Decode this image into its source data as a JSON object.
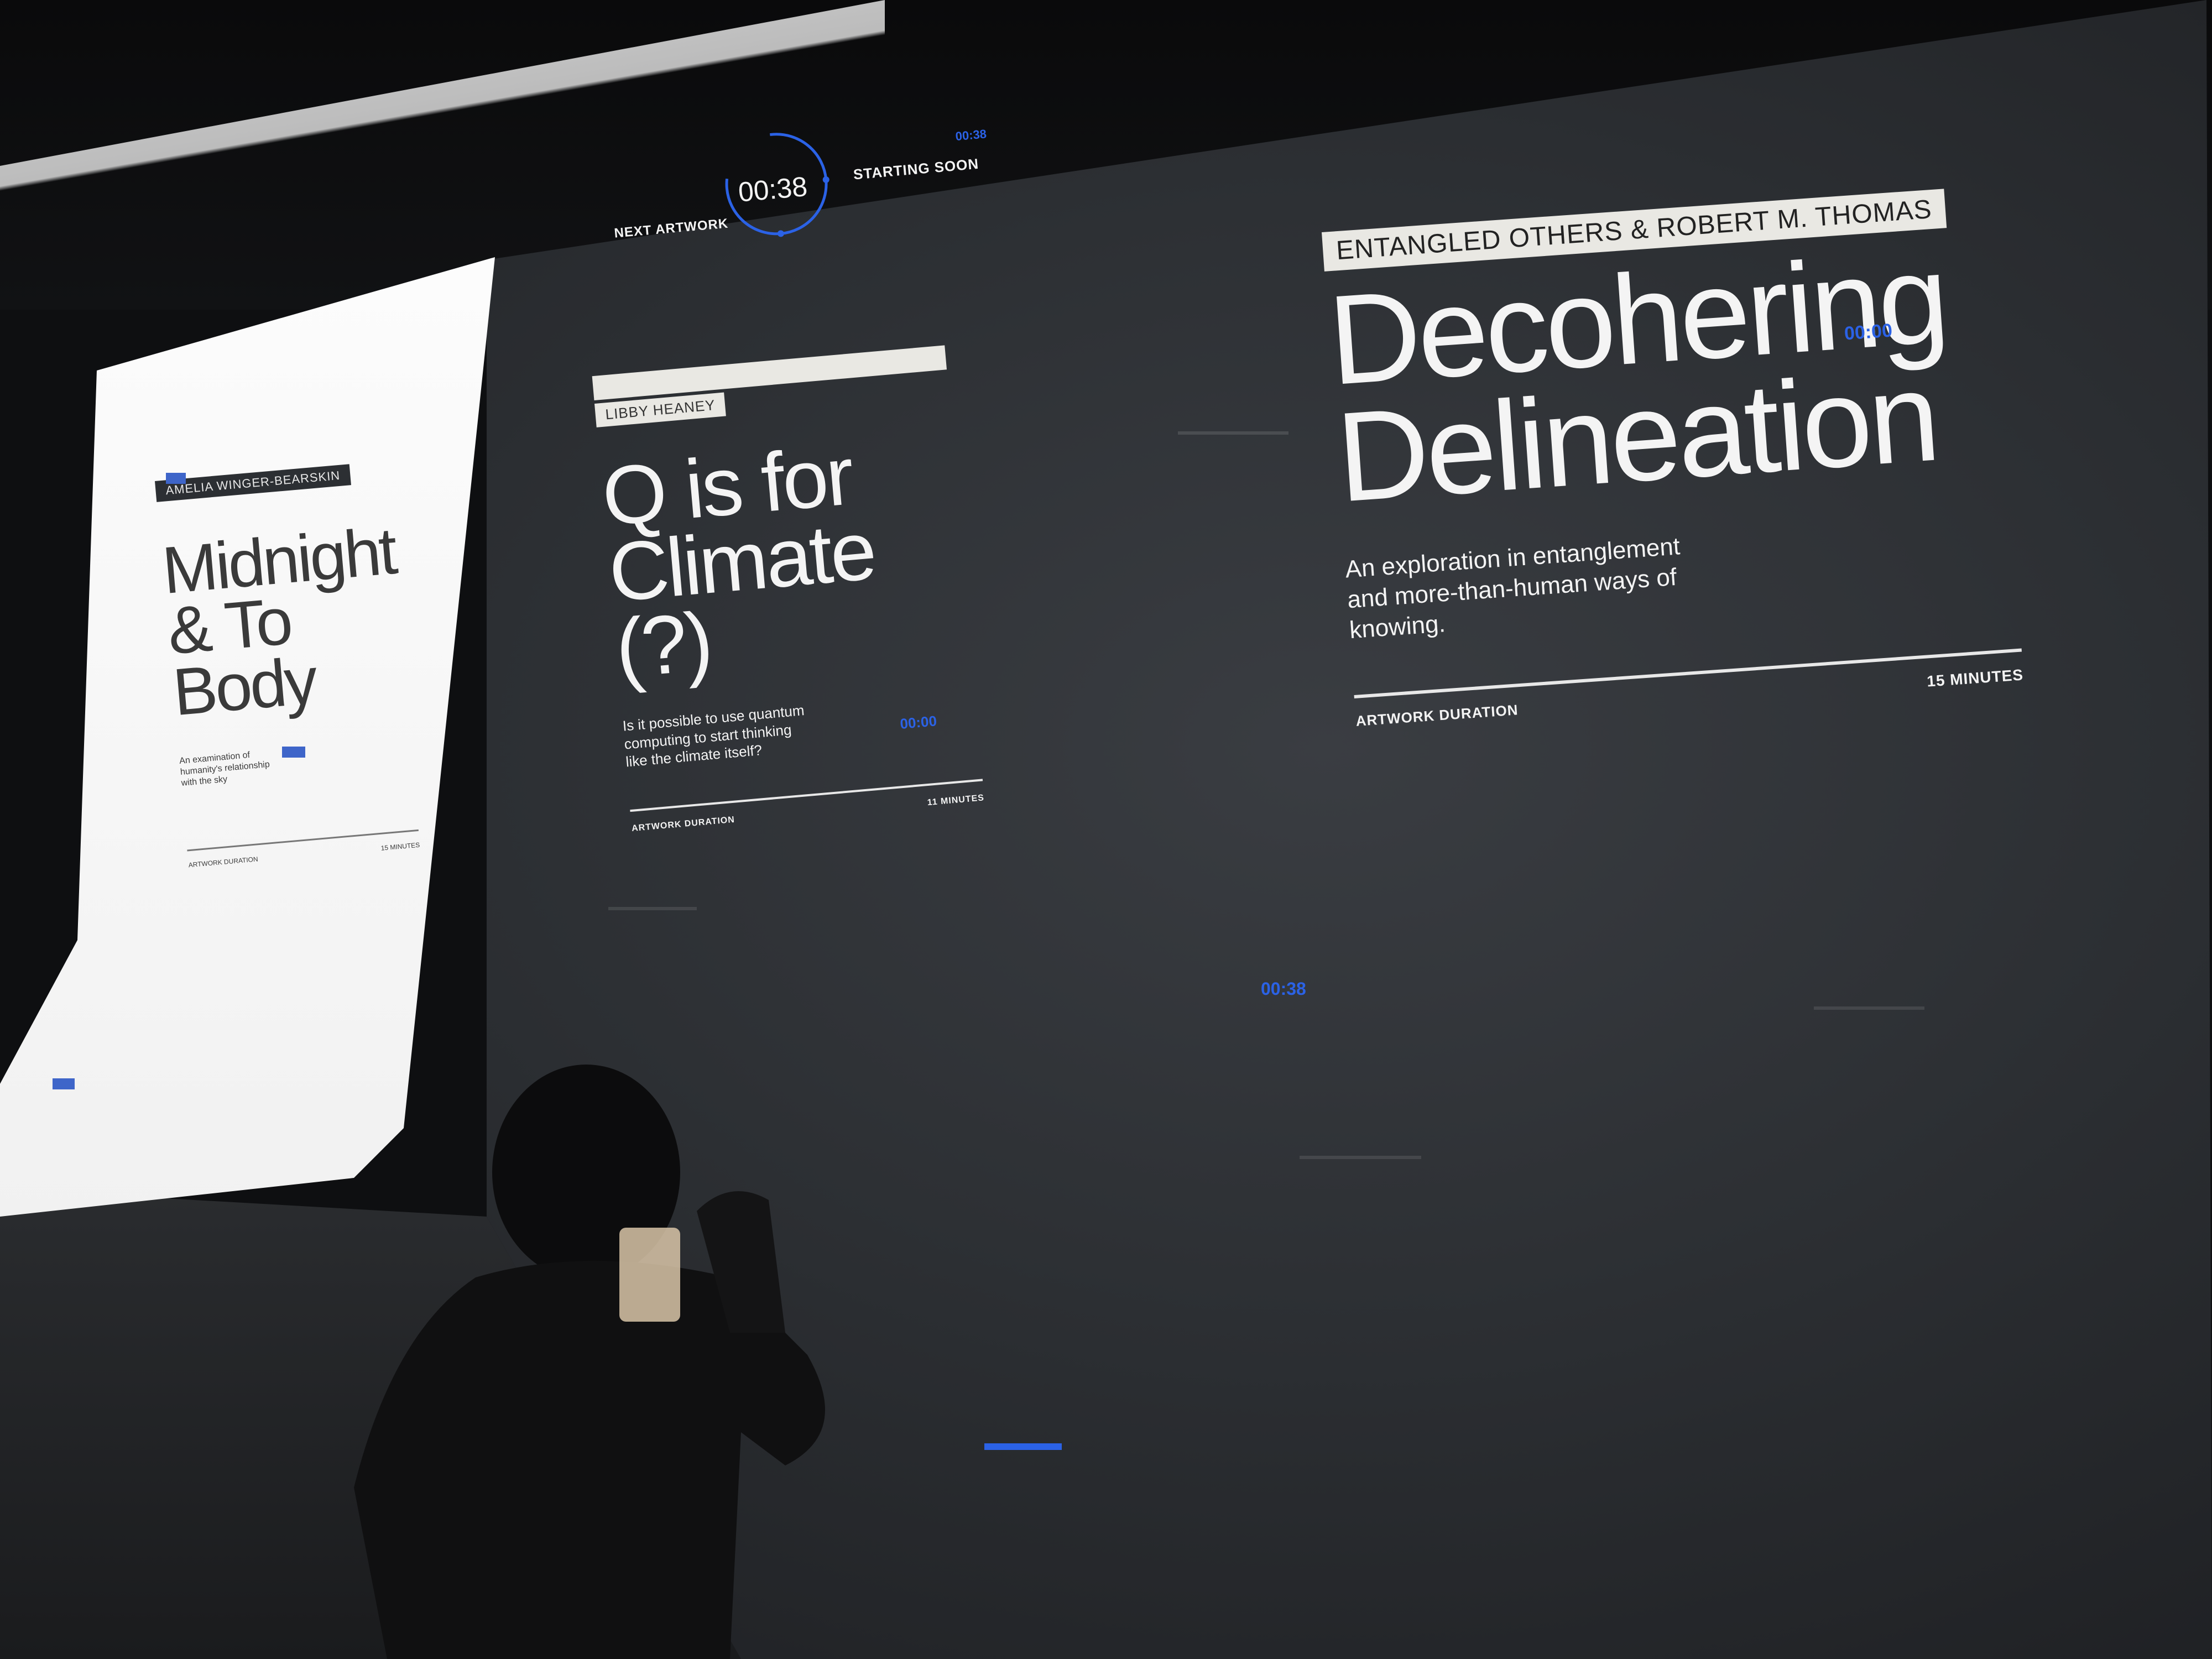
{
  "timer": {
    "label": "NEXT ARTWORK",
    "countdown": "00:38",
    "status": "STARTING SOON",
    "small_time": "00:38"
  },
  "left_panel": {
    "artist": "AMELIA WINGER-BEARSKIN",
    "title_line1": "Midnight",
    "title_line2": "& To Body",
    "description": "An examination of humanity's relationship with the sky",
    "duration_label": "ARTWORK DURATION",
    "duration_value": "15 MINUTES"
  },
  "middle_panel": {
    "artist": "LIBBY HEANEY",
    "title_line1": "Q is for",
    "title_line2": "Climate (?)",
    "description": "Is it possible to use quantum computing to start thinking like the climate itself?",
    "duration_label": "ARTWORK DURATION",
    "duration_value": "11 MINUTES",
    "timecode": "00:00"
  },
  "right_panel": {
    "artist": "ENTANGLED OTHERS & ROBERT M. THOMAS",
    "title_line1": "Decohering",
    "title_line2": "Delineation",
    "description": "An exploration in entanglement and more-than-human ways of knowing.",
    "duration_label": "ARTWORK DURATION",
    "duration_value": "15 MINUTES",
    "timecode": "00:00"
  },
  "floating_timecode": "00:38",
  "colors": {
    "accent_blue": "#2b62e6",
    "wall": "#2c2f33",
    "text_light": "#f4f4f4",
    "white_screen": "#ffffff"
  }
}
